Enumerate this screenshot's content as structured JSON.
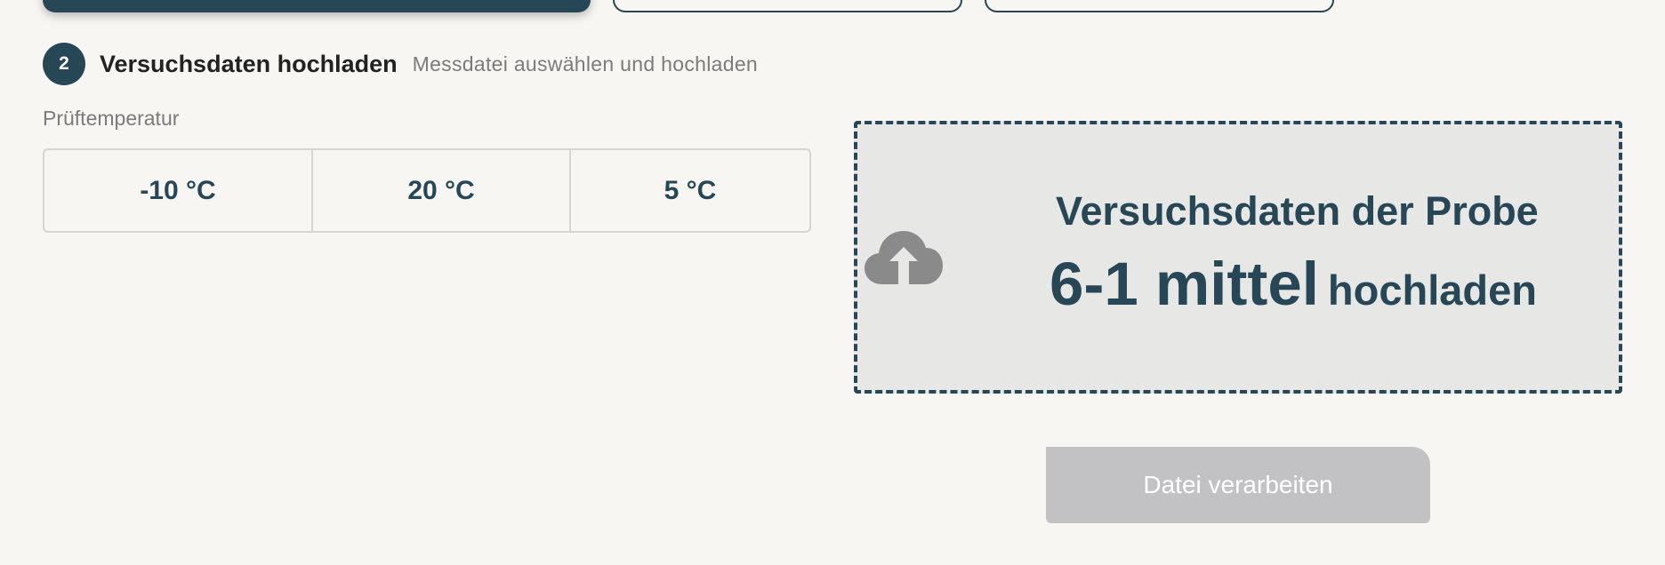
{
  "step": {
    "number": "2",
    "title": "Versuchsdaten hochladen",
    "subtitle": "Messdatei auswählen und hochladen"
  },
  "temperature": {
    "label": "Prüftemperatur",
    "options": [
      "-10 °C",
      "20 °C",
      "5 °C"
    ]
  },
  "upload": {
    "line1": "Versuchsdaten der Probe",
    "sample": "6-1 mittel",
    "action": "hochladen",
    "icon": "cloud-upload-icon"
  },
  "process_button": {
    "label": "Datei verarbeiten",
    "disabled": true
  },
  "colors": {
    "primary": "#274656",
    "background": "#f7f6f3",
    "dropzone_bg": "#e7e7e6",
    "disabled_button": "#c2c1c3",
    "muted_text": "#7b7b7b"
  }
}
